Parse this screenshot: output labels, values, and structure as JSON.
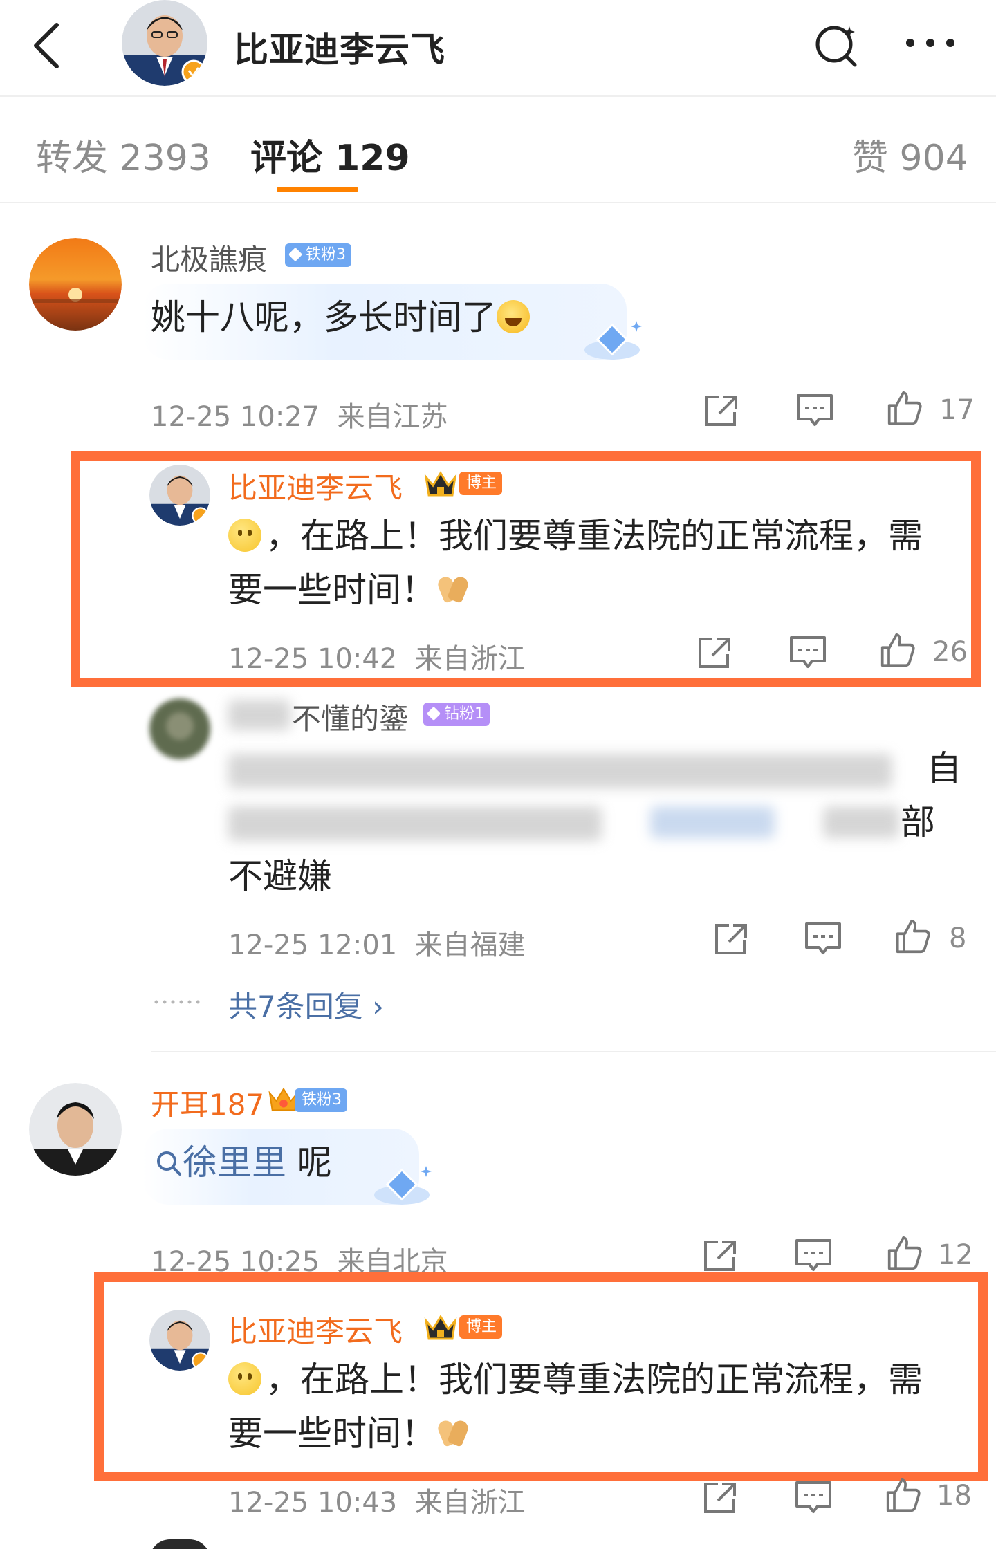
{
  "header": {
    "title": "比亚迪李云飞"
  },
  "tabs": [
    {
      "label": "转发 2393"
    },
    {
      "label": "评论 129"
    },
    {
      "label": "赞 904"
    }
  ],
  "comments": [
    {
      "username": "北极譙痕",
      "badge": "铁粉3",
      "text": "姚十八呢，多长时间了",
      "time": "12-25 10:27",
      "location": "来自江苏",
      "likes": "17",
      "replies": [
        {
          "username": "比亚迪李云飞",
          "badge": "博主",
          "text_line1": "，在路上！我们要尊重法院的正常流程，需",
          "text_line2": "要一些时间！",
          "time": "12-25 10:42",
          "location": "来自浙江",
          "likes": "26"
        },
        {
          "username": "不懂的鎏",
          "badge": "钻粉1",
          "text_visible_end_1": "自",
          "text_visible_end_2": "部",
          "text_line3": "不避嫌",
          "time": "12-25 12:01",
          "location": "来自福建",
          "likes": "8"
        }
      ],
      "more_replies": "共7条回复"
    },
    {
      "username": "开耳187",
      "badge": "铁粉3",
      "text_search": "徐里里",
      "text_rest": "呢",
      "time": "12-25 10:25",
      "location": "来自北京",
      "likes": "12",
      "replies": [
        {
          "username": "比亚迪李云飞",
          "badge": "博主",
          "text_line1": "，在路上！我们要尊重法院的正常流程，需",
          "text_line2": "要一些时间！",
          "time": "12-25 10:43",
          "location": "来自浙江",
          "likes": "18"
        }
      ]
    }
  ],
  "colors": {
    "accent": "#ff8200",
    "highlight": "#ff6f3a",
    "username_vip": "#f26b1d",
    "link": "#4a6fa5"
  }
}
